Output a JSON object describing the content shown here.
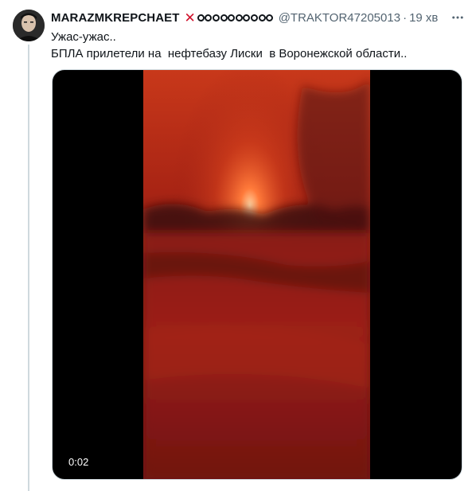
{
  "tweet": {
    "author_name": "MARAZMKREPCHAET",
    "handle": "@TRAKTOR47205013",
    "separator": "·",
    "time": "19 хв",
    "lines": [
      "Ужас-ужас..",
      "БПЛА прилетели на  нефтебазу Лиски  в Воронежской области.."
    ]
  },
  "media": {
    "duration": "0:02"
  },
  "icons": {
    "badge": "red-cross-icon",
    "decor": "ring-chain-icon",
    "more": "more-options-icon",
    "avatar": "avatar"
  },
  "colors": {
    "cross": "#d0112b",
    "secondary_text": "#536471",
    "thread_line": "#cfd9de"
  }
}
